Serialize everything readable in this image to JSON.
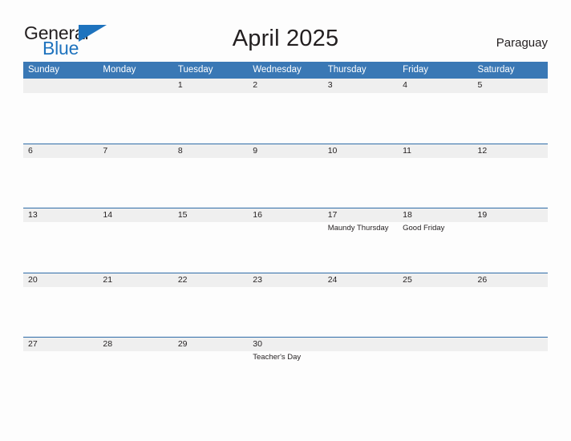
{
  "brand": {
    "name_part1": "General",
    "name_part2": "Blue",
    "triangle_color": "#1e73be"
  },
  "header": {
    "title": "April 2025",
    "location": "Paraguay"
  },
  "colors": {
    "header_blue": "#3a78b5",
    "row_line_blue": "#2f6ca8",
    "date_band_gray": "#efefef",
    "text": "#231f20",
    "brand_blue": "#1e73be",
    "page_background": "#fdfdfd"
  },
  "calendar": {
    "weekdays": [
      "Sunday",
      "Monday",
      "Tuesday",
      "Wednesday",
      "Thursday",
      "Friday",
      "Saturday"
    ],
    "weeks": [
      {
        "days": [
          {
            "date": "",
            "events": []
          },
          {
            "date": "",
            "events": []
          },
          {
            "date": "1",
            "events": []
          },
          {
            "date": "2",
            "events": []
          },
          {
            "date": "3",
            "events": []
          },
          {
            "date": "4",
            "events": []
          },
          {
            "date": "5",
            "events": []
          }
        ]
      },
      {
        "days": [
          {
            "date": "6",
            "events": []
          },
          {
            "date": "7",
            "events": []
          },
          {
            "date": "8",
            "events": []
          },
          {
            "date": "9",
            "events": []
          },
          {
            "date": "10",
            "events": []
          },
          {
            "date": "11",
            "events": []
          },
          {
            "date": "12",
            "events": []
          }
        ]
      },
      {
        "days": [
          {
            "date": "13",
            "events": []
          },
          {
            "date": "14",
            "events": []
          },
          {
            "date": "15",
            "events": []
          },
          {
            "date": "16",
            "events": []
          },
          {
            "date": "17",
            "events": [
              "Maundy Thursday"
            ]
          },
          {
            "date": "18",
            "events": [
              "Good Friday"
            ]
          },
          {
            "date": "19",
            "events": []
          }
        ]
      },
      {
        "days": [
          {
            "date": "20",
            "events": []
          },
          {
            "date": "21",
            "events": []
          },
          {
            "date": "22",
            "events": []
          },
          {
            "date": "23",
            "events": []
          },
          {
            "date": "24",
            "events": []
          },
          {
            "date": "25",
            "events": []
          },
          {
            "date": "26",
            "events": []
          }
        ]
      },
      {
        "days": [
          {
            "date": "27",
            "events": []
          },
          {
            "date": "28",
            "events": []
          },
          {
            "date": "29",
            "events": []
          },
          {
            "date": "30",
            "events": [
              "Teacher's Day"
            ]
          },
          {
            "date": "",
            "events": []
          },
          {
            "date": "",
            "events": []
          },
          {
            "date": "",
            "events": []
          }
        ]
      }
    ]
  }
}
